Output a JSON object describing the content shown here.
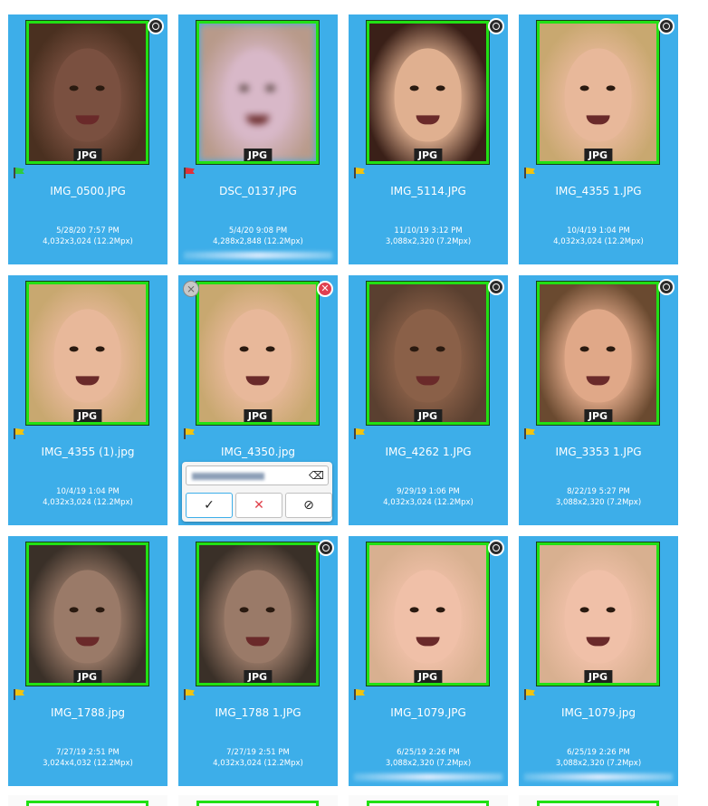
{
  "tiles": [
    {
      "filename": "IMG_0500.JPG",
      "date": "5/28/20 7:57 PM",
      "dims": "4,032x3,024 (12.2Mpx)",
      "badge": "JPG",
      "flag_color": "#2ecc40",
      "globe": true,
      "skin": "#7a5040",
      "bg": "#4a3020",
      "blurred": false
    },
    {
      "filename": "DSC_0137.JPG",
      "date": "5/4/20 9:08 PM",
      "dims": "4,288x2,848 (12.2Mpx)",
      "badge": "JPG",
      "flag_color": "#e0303a",
      "globe": false,
      "skin": "#d8b8c8",
      "bg": "#b89a8a",
      "blurred": true
    },
    {
      "filename": "IMG_5114.JPG",
      "date": "11/10/19 3:12 PM",
      "dims": "3,088x2,320 (7.2Mpx)",
      "badge": "JPG",
      "flag_color": "#f1c40f",
      "globe": true,
      "skin": "#e0b090",
      "bg": "#3a2018",
      "blurred": false
    },
    {
      "filename": "IMG_4355 1.JPG",
      "date": "10/4/19 1:04 PM",
      "dims": "4,032x3,024 (12.2Mpx)",
      "badge": "JPG",
      "flag_color": "#f1c40f",
      "globe": true,
      "skin": "#e8b89a",
      "bg": "#c8a870",
      "blurred": false
    },
    {
      "filename": "IMG_4355 (1).jpg",
      "date": "10/4/19 1:04 PM",
      "dims": "4,032x3,024 (12.2Mpx)",
      "badge": "JPG",
      "flag_color": "#f1c40f",
      "globe": false,
      "skin": "#e8b89a",
      "bg": "#c8a870",
      "blurred": false
    },
    {
      "filename": "IMG_4350.jpg",
      "date": "",
      "dims": "",
      "badge": "JPG",
      "flag_color": "#f1c40f",
      "globe": false,
      "skin": "#e8b89a",
      "bg": "#c8a870",
      "blurred": false,
      "editing": true
    },
    {
      "filename": "IMG_4262 1.JPG",
      "date": "9/29/19 1:06 PM",
      "dims": "4,032x3,024 (12.2Mpx)",
      "badge": "JPG",
      "flag_color": "#f1c40f",
      "globe": true,
      "skin": "#8a6048",
      "bg": "#5a4030",
      "blurred": false
    },
    {
      "filename": "IMG_3353 1.JPG",
      "date": "8/22/19 5:27 PM",
      "dims": "3,088x2,320 (7.2Mpx)",
      "badge": "JPG",
      "flag_color": "#f1c40f",
      "globe": true,
      "skin": "#e0a888",
      "bg": "#6a4a30",
      "blurred": false
    },
    {
      "filename": "IMG_1788.jpg",
      "date": "7/27/19 2:51 PM",
      "dims": "3,024x4,032 (12.2Mpx)",
      "badge": "JPG",
      "flag_color": "#f1c40f",
      "globe": false,
      "skin": "#9a7a68",
      "bg": "#3a3028",
      "blurred": false
    },
    {
      "filename": "IMG_1788 1.JPG",
      "date": "7/27/19 2:51 PM",
      "dims": "4,032x3,024 (12.2Mpx)",
      "badge": "JPG",
      "flag_color": "#f1c40f",
      "globe": true,
      "skin": "#9a7a68",
      "bg": "#3a3028",
      "blurred": false
    },
    {
      "filename": "IMG_1079.JPG",
      "date": "6/25/19 2:26 PM",
      "dims": "3,088x2,320 (7.2Mpx)",
      "badge": "JPG",
      "flag_color": "#f1c40f",
      "globe": true,
      "skin": "#f0c0a8",
      "bg": "#d8b090",
      "blurred": false
    },
    {
      "filename": "IMG_1079.jpg",
      "date": "6/25/19 2:26 PM",
      "dims": "3,088x2,320 (7.2Mpx)",
      "badge": "JPG",
      "flag_color": "#f1c40f",
      "globe": false,
      "skin": "#f0c0a8",
      "bg": "#d8b090",
      "blurred": false
    }
  ],
  "popup": {
    "accept_icon": "✓",
    "reject_icon": "✕",
    "ignore_icon": "⊘",
    "clear_icon": "⌫"
  },
  "icons": {
    "globe": "globe-icon",
    "flag": "flag-icon",
    "deselect": "⨯",
    "remove": "✕"
  }
}
